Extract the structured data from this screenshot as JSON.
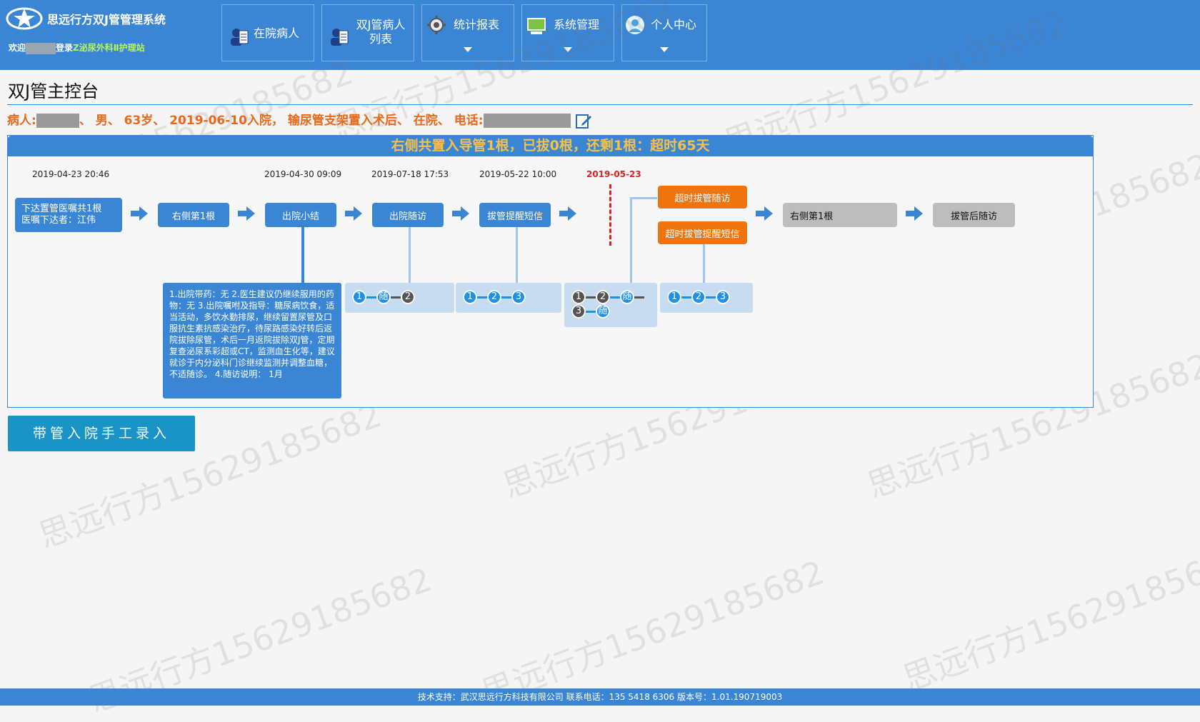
{
  "app": {
    "title": "思远行方双J管管理系统",
    "welcome_prefix": "欢迎",
    "welcome_mid": "登录",
    "station": "Z泌尿外科Ⅱ护理站"
  },
  "nav": {
    "items": [
      {
        "label": "在院病人"
      },
      {
        "label": "双J管病人列表"
      },
      {
        "label": "统计报表"
      },
      {
        "label": "系统管理"
      },
      {
        "label": "个人中心"
      }
    ]
  },
  "page": {
    "title": "双J管主控台",
    "patient_prefix": "病人:",
    "patient_info": "、 男、 63岁、 2019-06-10入院， 输尿管支架置入术后、 在院、 电话:"
  },
  "banner": "右侧共置入导管1根，已拔0根，还剩1根：超时65天",
  "timeline": {
    "dates": [
      "2019-04-23 20:46",
      "2019-04-30 09:09",
      "2019-07-18 17:53",
      "2019-05-22 10:00",
      "2019-05-23"
    ],
    "nodes": {
      "order_line1": "下达置管医嘱共1根",
      "order_line2": "医嘱下达者：江伟",
      "right_first": "右侧第1根",
      "discharge": "出院小结",
      "followup": "出院随访",
      "remind_sms": "拔管提醒短信",
      "overdue_followup": "超时拔管随访",
      "overdue_sms": "超时拔管提醒短信",
      "right_first_gray": "右侧第1根",
      "post_followup": "拔管后随访"
    },
    "summary": "1.出院带药：无 2.医生建议仍继续服用的药物：无 3.出院嘱咐及指导：糖尿病饮食，适当活动，多饮水勤排尿，继续留置尿管及口服抗生素抗感染治疗，待尿路感染好转后返院拔除尿管，术后一月返院拔除双J管，定期复查泌尿系彩超或CT，监测血生化等，建议就诊于内分泌科门诊继续监测并调整血糖，不适随诊。 4.随访说明： 1月",
    "steps": {
      "one": "1",
      "two": "2",
      "three": "3",
      "sui": "随"
    }
  },
  "manual_button": "带管入院手工录入",
  "footer": "技术支持：武汉思远行方科技有限公司  联系电话：135 5418 6306  版本号：1.01.190719003",
  "watermark": "思远行方15629185682",
  "colors": {
    "primary": "#3a86d4",
    "orange": "#f07410",
    "warning_text": "#f5c14a",
    "patient_text": "#e8691a",
    "due_line": "#e02020"
  }
}
